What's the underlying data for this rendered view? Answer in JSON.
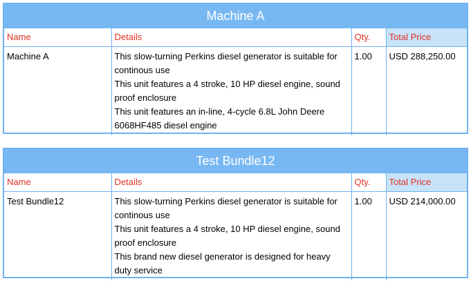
{
  "sections": [
    {
      "title": "Machine A",
      "headers": {
        "name": "Name",
        "details": "Details",
        "qty": "Qty.",
        "price": "Total Price"
      },
      "row": {
        "name": "Machine A",
        "details": [
          "This slow-turning Perkins diesel generator is suitable for continous use",
          "This unit features a 4 stroke, 10 HP diesel engine, sound proof enclosure",
          "This unit features an in-line, 4-cycle 6.8L John Deere 6068HF485 diesel engine"
        ],
        "qty": "1.00",
        "price": "USD 288,250.00"
      }
    },
    {
      "title": "Test Bundle12",
      "headers": {
        "name": "Name",
        "details": "Details",
        "qty": "Qty.",
        "price": "Total Price"
      },
      "row": {
        "name": "Test Bundle12",
        "details": [
          "This slow-turning Perkins diesel generator is suitable for continous use",
          "This unit features a 4 stroke, 10 HP diesel engine, sound proof enclosure",
          "This brand new diesel generator is designed for heavy duty service"
        ],
        "qty": "1.00",
        "price": "USD 214,000.00"
      }
    }
  ],
  "colors": {
    "header_bar": "#78b8f2",
    "border": "#6fb1ef",
    "column_header_text": "#e03121",
    "price_header_bg": "#c7e3fa"
  }
}
